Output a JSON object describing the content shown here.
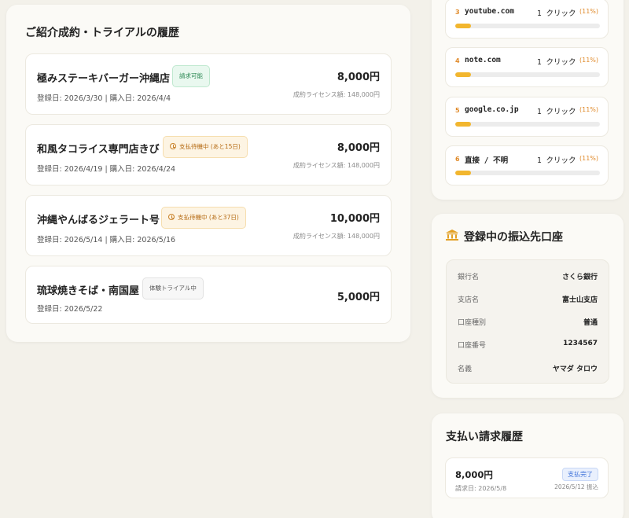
{
  "history": {
    "title": "ご紹介成約・トライアルの履歴",
    "items": [
      {
        "name": "極みステーキバーガー沖縄店",
        "badge": "請求可能",
        "dates": "登録日: 2026/3/30 | 購入日: 2026/4/4",
        "amount": "8,000円",
        "license": "成約ライセンス額: 148,000円"
      },
      {
        "name": "和風タコライス専門店きび",
        "badge": "支払待機中 (あと15日)",
        "dates": "登録日: 2026/4/19 | 購入日: 2026/4/24",
        "amount": "8,000円",
        "license": "成約ライセンス額: 148,000円"
      },
      {
        "name": "沖縄やんばるジェラート号",
        "badge": "支払待機中 (あと37日)",
        "dates": "登録日: 2026/5/14 | 購入日: 2026/5/16",
        "amount": "10,000円",
        "license": "成約ライセンス額: 148,000円"
      },
      {
        "name": "琉球焼きそば・南国屋",
        "badge": "体験トライアル中",
        "dates": "登録日: 2026/5/22",
        "amount": "5,000円"
      }
    ]
  },
  "sources": {
    "items": [
      {
        "rank": "3",
        "domain": "youtube.com",
        "clicks": "1 クリック",
        "pct": "(11%)",
        "fill": 0.11
      },
      {
        "rank": "4",
        "domain": "note.com",
        "clicks": "1 クリック",
        "pct": "(11%)",
        "fill": 0.11
      },
      {
        "rank": "5",
        "domain": "google.co.jp",
        "clicks": "1 クリック",
        "pct": "(11%)",
        "fill": 0.11
      },
      {
        "rank": "6",
        "domain": "直接 / 不明",
        "clicks": "1 クリック",
        "pct": "(11%)",
        "fill": 0.11
      }
    ]
  },
  "bank": {
    "title": "登録中の振込先口座",
    "icon": "bank-icon",
    "rows": [
      {
        "label": "銀行名",
        "value": "さくら銀行"
      },
      {
        "label": "支店名",
        "value": "富士山支店"
      },
      {
        "label": "口座種別",
        "value": "普通"
      },
      {
        "label": "口座番号",
        "value": "1234567"
      },
      {
        "label": "名義",
        "value": "ヤマダ タロウ"
      }
    ]
  },
  "payments": {
    "title": "支払い請求履歴",
    "items": [
      {
        "amount": "8,000円",
        "requested": "請求日: 2026/5/8",
        "status": "支払完了",
        "paid": "2026/5/12 振込"
      }
    ]
  },
  "colors": {
    "accent": "#e08a2a",
    "bar_fill": "#f2b62e",
    "success": "#2e8a55",
    "warning": "#b56a12",
    "info": "#3a6fd8"
  }
}
